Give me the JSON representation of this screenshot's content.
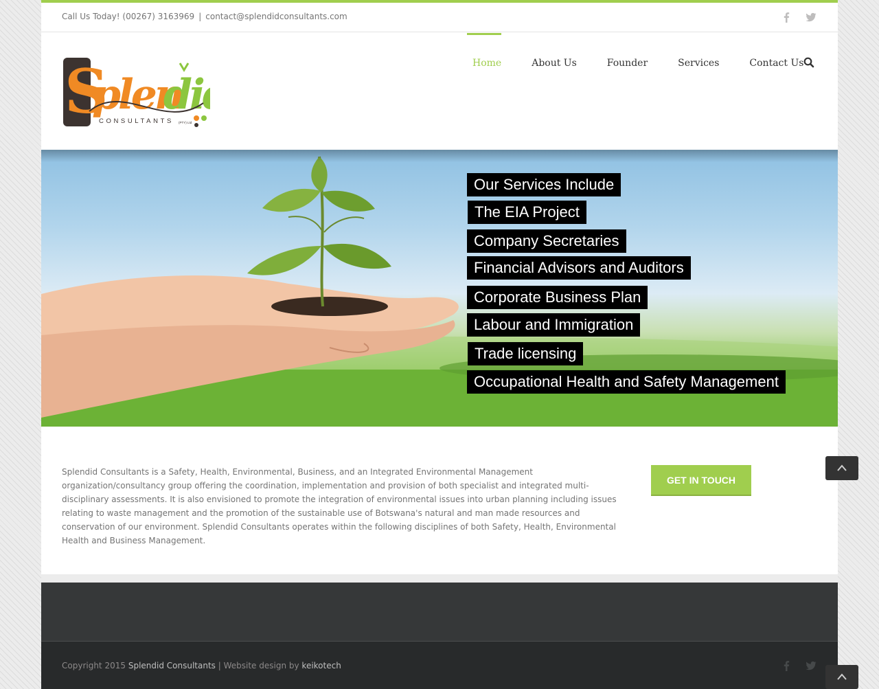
{
  "topbar": {
    "phone": "Call Us Today! (00267) 3163969",
    "separator": "|",
    "email": "contact@splendidconsultants.com",
    "social_icons": [
      "facebook-icon",
      "twitter-icon"
    ]
  },
  "logo": {
    "text": "Splendid",
    "subtext": "CONSULTANTS",
    "suffix": "(PTY) Ltd"
  },
  "nav": {
    "items": [
      {
        "label": "Home",
        "active": true
      },
      {
        "label": "About Us",
        "active": false
      },
      {
        "label": "Founder",
        "active": false
      },
      {
        "label": "Services",
        "active": false
      },
      {
        "label": "Contact Us",
        "active": false
      }
    ],
    "search_icon": "search-icon"
  },
  "hero": {
    "services": [
      "Our Services Include",
      "The EIA Project",
      "Company Secretaries",
      "Financial Advisors and Auditors",
      "Corporate Business Plan",
      "Labour and Immigration",
      "Trade licensing",
      "Occupational Health and Safety Management"
    ]
  },
  "content": {
    "about": "Splendid Consultants is a Safety, Health, Environmental, Business, and an Integrated Environmental Management organization/consultancy group offering the coordination, implementation and provision of both specialist and integrated multi-disciplinary assessments. It is also envisioned to promote the integration of environmental issues into urban planning including issues relating to waste management and the promotion of the sustainable use of Botswana's natural and man made resources and conservation of our environment. Splendid Consultants operates within the following disciplines of both Safety, Health, Environmental Health and Business Management.",
    "cta_label": "GET IN TOUCH"
  },
  "footer": {
    "copyright_prefix": "Copyright 2015",
    "company": "Splendid Consultants",
    "design_prefix": "| Website design by",
    "designer": "keikotech",
    "social_icons": [
      "facebook-icon",
      "twitter-icon"
    ]
  },
  "colors": {
    "accent": "#a0ce4e",
    "logo_orange": "#f08a24",
    "footer_dark": "#363839",
    "footer_bottom": "#282a2b"
  }
}
